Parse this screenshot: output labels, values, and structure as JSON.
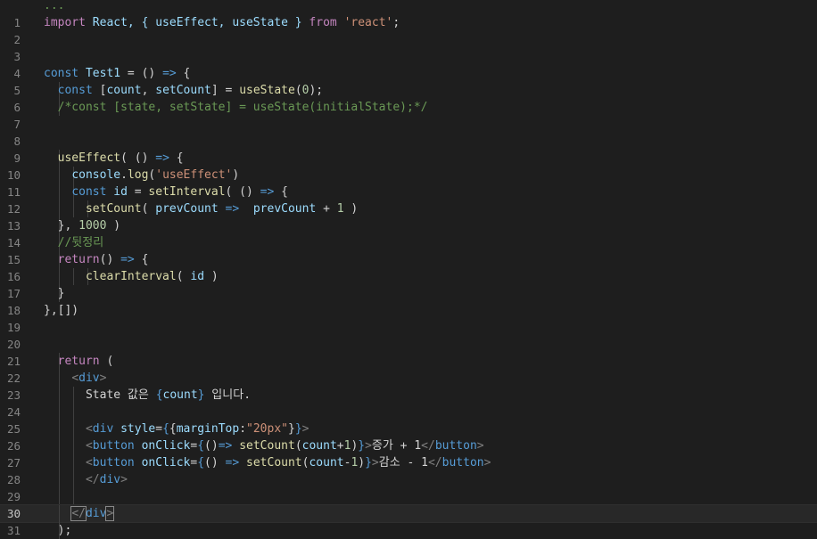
{
  "editor": {
    "language": "javascript-react",
    "active_line": 30,
    "lines": [
      {
        "n": "",
        "tokens": [
          {
            "t": "...",
            "c": "com"
          }
        ]
      },
      {
        "n": "1",
        "tokens": [
          {
            "t": "import",
            "c": "kw"
          },
          {
            "t": " React, { useEffect, useState } ",
            "c": "var"
          },
          {
            "t": "from",
            "c": "kw"
          },
          {
            "t": " ",
            "c": "op"
          },
          {
            "t": "'react'",
            "c": "str"
          },
          {
            "t": ";",
            "c": "op"
          }
        ]
      },
      {
        "n": "2",
        "tokens": []
      },
      {
        "n": "3",
        "tokens": []
      },
      {
        "n": "4",
        "tokens": [
          {
            "t": "const",
            "c": "st"
          },
          {
            "t": " ",
            "c": "op"
          },
          {
            "t": "Test1",
            "c": "var"
          },
          {
            "t": " = () ",
            "c": "op"
          },
          {
            "t": "=>",
            "c": "st"
          },
          {
            "t": " {",
            "c": "op"
          }
        ]
      },
      {
        "n": "5",
        "tokens": [
          {
            "t": "  ",
            "c": "op"
          },
          {
            "t": "const",
            "c": "st"
          },
          {
            "t": " [",
            "c": "op"
          },
          {
            "t": "count",
            "c": "var"
          },
          {
            "t": ", ",
            "c": "op"
          },
          {
            "t": "setCount",
            "c": "var"
          },
          {
            "t": "] = ",
            "c": "op"
          },
          {
            "t": "useState",
            "c": "fn"
          },
          {
            "t": "(",
            "c": "op"
          },
          {
            "t": "0",
            "c": "num"
          },
          {
            "t": ");",
            "c": "op"
          }
        ]
      },
      {
        "n": "6",
        "tokens": [
          {
            "t": "  ",
            "c": "op"
          },
          {
            "t": "/*const [state, setState] = useState(initialState);*/",
            "c": "com"
          }
        ]
      },
      {
        "n": "7",
        "tokens": []
      },
      {
        "n": "8",
        "tokens": []
      },
      {
        "n": "9",
        "tokens": [
          {
            "t": "  ",
            "c": "op"
          },
          {
            "t": "useEffect",
            "c": "fn"
          },
          {
            "t": "( () ",
            "c": "op"
          },
          {
            "t": "=>",
            "c": "st"
          },
          {
            "t": " {",
            "c": "op"
          }
        ]
      },
      {
        "n": "10",
        "tokens": [
          {
            "t": "    ",
            "c": "op"
          },
          {
            "t": "console",
            "c": "var"
          },
          {
            "t": ".",
            "c": "op"
          },
          {
            "t": "log",
            "c": "fn"
          },
          {
            "t": "(",
            "c": "op"
          },
          {
            "t": "'useEffect'",
            "c": "str"
          },
          {
            "t": ")",
            "c": "op"
          }
        ]
      },
      {
        "n": "11",
        "tokens": [
          {
            "t": "    ",
            "c": "op"
          },
          {
            "t": "const",
            "c": "st"
          },
          {
            "t": " ",
            "c": "op"
          },
          {
            "t": "id",
            "c": "var"
          },
          {
            "t": " = ",
            "c": "op"
          },
          {
            "t": "setInterval",
            "c": "fn"
          },
          {
            "t": "( () ",
            "c": "op"
          },
          {
            "t": "=>",
            "c": "st"
          },
          {
            "t": " {",
            "c": "op"
          }
        ]
      },
      {
        "n": "12",
        "tokens": [
          {
            "t": "      ",
            "c": "op"
          },
          {
            "t": "setCount",
            "c": "fn"
          },
          {
            "t": "( ",
            "c": "op"
          },
          {
            "t": "prevCount",
            "c": "var"
          },
          {
            "t": " ",
            "c": "op"
          },
          {
            "t": "=>",
            "c": "st"
          },
          {
            "t": "  ",
            "c": "op"
          },
          {
            "t": "prevCount",
            "c": "var"
          },
          {
            "t": " + ",
            "c": "op"
          },
          {
            "t": "1",
            "c": "num"
          },
          {
            "t": " )",
            "c": "op"
          }
        ]
      },
      {
        "n": "13",
        "tokens": [
          {
            "t": "  }, ",
            "c": "op"
          },
          {
            "t": "1000",
            "c": "num"
          },
          {
            "t": " )",
            "c": "op"
          }
        ]
      },
      {
        "n": "14",
        "tokens": [
          {
            "t": "  ",
            "c": "op"
          },
          {
            "t": "//뒷정리",
            "c": "com"
          }
        ]
      },
      {
        "n": "15",
        "tokens": [
          {
            "t": "  ",
            "c": "op"
          },
          {
            "t": "return",
            "c": "kw"
          },
          {
            "t": "() ",
            "c": "op"
          },
          {
            "t": "=>",
            "c": "st"
          },
          {
            "t": " {",
            "c": "op"
          }
        ]
      },
      {
        "n": "16",
        "tokens": [
          {
            "t": "      ",
            "c": "op"
          },
          {
            "t": "clearInterval",
            "c": "fn"
          },
          {
            "t": "( ",
            "c": "op"
          },
          {
            "t": "id",
            "c": "var"
          },
          {
            "t": " )",
            "c": "op"
          }
        ]
      },
      {
        "n": "17",
        "tokens": [
          {
            "t": "  }",
            "c": "op"
          }
        ]
      },
      {
        "n": "18",
        "tokens": [
          {
            "t": "},[])",
            "c": "op"
          }
        ]
      },
      {
        "n": "19",
        "tokens": []
      },
      {
        "n": "20",
        "tokens": []
      },
      {
        "n": "21",
        "tokens": [
          {
            "t": "  ",
            "c": "op"
          },
          {
            "t": "return",
            "c": "kw"
          },
          {
            "t": " (",
            "c": "op"
          }
        ]
      },
      {
        "n": "22",
        "tokens": [
          {
            "t": "    ",
            "c": "op"
          },
          {
            "t": "<",
            "c": "br"
          },
          {
            "t": "div",
            "c": "tag"
          },
          {
            "t": ">",
            "c": "br"
          }
        ]
      },
      {
        "n": "23",
        "tokens": [
          {
            "t": "      ",
            "c": "op"
          },
          {
            "t": "State 값은 ",
            "c": "txt"
          },
          {
            "t": "{",
            "c": "st"
          },
          {
            "t": "count",
            "c": "var"
          },
          {
            "t": "}",
            "c": "st"
          },
          {
            "t": " 입니다.",
            "c": "txt"
          }
        ]
      },
      {
        "n": "24",
        "tokens": []
      },
      {
        "n": "25",
        "tokens": [
          {
            "t": "      ",
            "c": "op"
          },
          {
            "t": "<",
            "c": "br"
          },
          {
            "t": "div",
            "c": "tag"
          },
          {
            "t": " ",
            "c": "op"
          },
          {
            "t": "style",
            "c": "attr"
          },
          {
            "t": "=",
            "c": "op"
          },
          {
            "t": "{",
            "c": "st"
          },
          {
            "t": "{",
            "c": "op"
          },
          {
            "t": "marginTop",
            "c": "attr"
          },
          {
            "t": ":",
            "c": "op"
          },
          {
            "t": "\"20px\"",
            "c": "str"
          },
          {
            "t": "}",
            "c": "op"
          },
          {
            "t": "}",
            "c": "st"
          },
          {
            "t": ">",
            "c": "br"
          }
        ]
      },
      {
        "n": "26",
        "tokens": [
          {
            "t": "      ",
            "c": "op"
          },
          {
            "t": "<",
            "c": "br"
          },
          {
            "t": "button",
            "c": "tag"
          },
          {
            "t": " ",
            "c": "op"
          },
          {
            "t": "onClick",
            "c": "attr"
          },
          {
            "t": "=",
            "c": "op"
          },
          {
            "t": "{",
            "c": "st"
          },
          {
            "t": "()",
            "c": "op"
          },
          {
            "t": "=>",
            "c": "st"
          },
          {
            "t": " ",
            "c": "op"
          },
          {
            "t": "setCount",
            "c": "fn"
          },
          {
            "t": "(",
            "c": "op"
          },
          {
            "t": "count",
            "c": "var"
          },
          {
            "t": "+",
            "c": "op"
          },
          {
            "t": "1",
            "c": "num"
          },
          {
            "t": ")",
            "c": "op"
          },
          {
            "t": "}",
            "c": "st"
          },
          {
            "t": ">",
            "c": "br"
          },
          {
            "t": "증가 + 1",
            "c": "txt"
          },
          {
            "t": "</",
            "c": "br"
          },
          {
            "t": "button",
            "c": "tag"
          },
          {
            "t": ">",
            "c": "br"
          }
        ]
      },
      {
        "n": "27",
        "tokens": [
          {
            "t": "      ",
            "c": "op"
          },
          {
            "t": "<",
            "c": "br"
          },
          {
            "t": "button",
            "c": "tag"
          },
          {
            "t": " ",
            "c": "op"
          },
          {
            "t": "onClick",
            "c": "attr"
          },
          {
            "t": "=",
            "c": "op"
          },
          {
            "t": "{",
            "c": "st"
          },
          {
            "t": "() ",
            "c": "op"
          },
          {
            "t": "=>",
            "c": "st"
          },
          {
            "t": " ",
            "c": "op"
          },
          {
            "t": "setCount",
            "c": "fn"
          },
          {
            "t": "(",
            "c": "op"
          },
          {
            "t": "count",
            "c": "var"
          },
          {
            "t": "-",
            "c": "op"
          },
          {
            "t": "1",
            "c": "num"
          },
          {
            "t": ")",
            "c": "op"
          },
          {
            "t": "}",
            "c": "st"
          },
          {
            "t": ">",
            "c": "br"
          },
          {
            "t": "감소 - 1",
            "c": "txt"
          },
          {
            "t": "</",
            "c": "br"
          },
          {
            "t": "button",
            "c": "tag"
          },
          {
            "t": ">",
            "c": "br"
          }
        ]
      },
      {
        "n": "28",
        "tokens": [
          {
            "t": "      ",
            "c": "op"
          },
          {
            "t": "</",
            "c": "br"
          },
          {
            "t": "div",
            "c": "tag"
          },
          {
            "t": ">",
            "c": "br"
          }
        ]
      },
      {
        "n": "29",
        "tokens": []
      },
      {
        "n": "30",
        "tokens": [
          {
            "t": "    ",
            "c": "op"
          },
          {
            "t": "</",
            "c": "br"
          },
          {
            "t": "div",
            "c": "tag"
          },
          {
            "t": ">",
            "c": "br"
          }
        ]
      },
      {
        "n": "31",
        "tokens": [
          {
            "t": "  );",
            "c": "op"
          }
        ]
      }
    ]
  },
  "colors": {
    "background": "#1e1e1e",
    "line_number": "#858585",
    "keyword": "#c586c0",
    "storage": "#569cd6",
    "function": "#dcdcaa",
    "variable": "#9cdcfe",
    "string": "#ce9178",
    "number": "#b5cea8",
    "comment": "#6a9955"
  }
}
